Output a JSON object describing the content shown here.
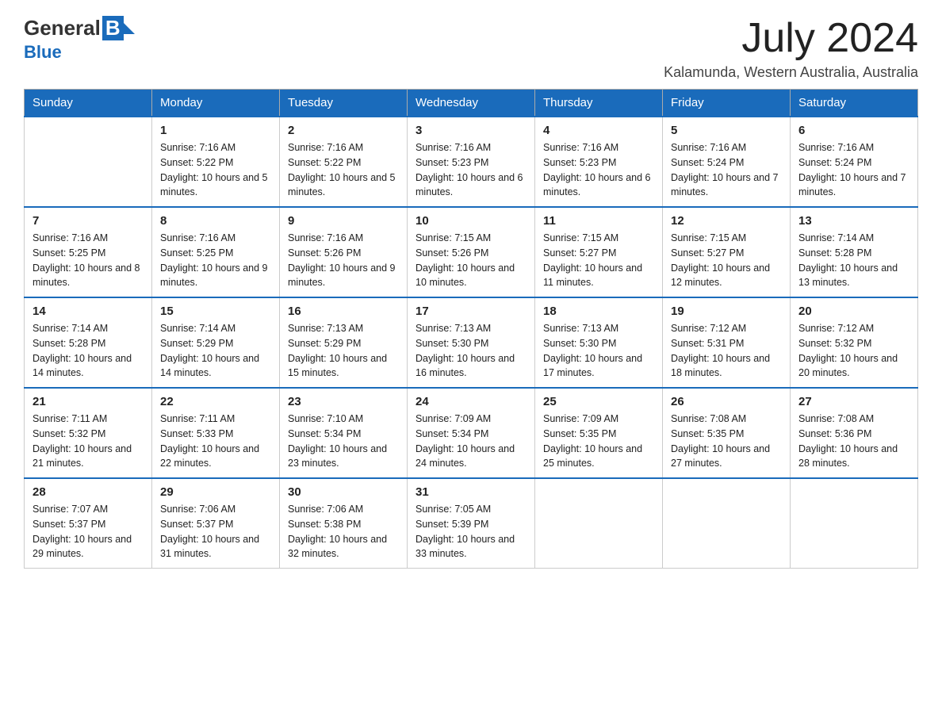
{
  "logo": {
    "general": "General",
    "blue": "Blue",
    "subtitle": "Blue"
  },
  "title": {
    "month_year": "July 2024",
    "location": "Kalamunda, Western Australia, Australia"
  },
  "days_of_week": [
    "Sunday",
    "Monday",
    "Tuesday",
    "Wednesday",
    "Thursday",
    "Friday",
    "Saturday"
  ],
  "weeks": [
    [
      null,
      {
        "day": "1",
        "sunrise": "7:16 AM",
        "sunset": "5:22 PM",
        "daylight": "10 hours and 5 minutes."
      },
      {
        "day": "2",
        "sunrise": "7:16 AM",
        "sunset": "5:22 PM",
        "daylight": "10 hours and 5 minutes."
      },
      {
        "day": "3",
        "sunrise": "7:16 AM",
        "sunset": "5:23 PM",
        "daylight": "10 hours and 6 minutes."
      },
      {
        "day": "4",
        "sunrise": "7:16 AM",
        "sunset": "5:23 PM",
        "daylight": "10 hours and 6 minutes."
      },
      {
        "day": "5",
        "sunrise": "7:16 AM",
        "sunset": "5:24 PM",
        "daylight": "10 hours and 7 minutes."
      },
      {
        "day": "6",
        "sunrise": "7:16 AM",
        "sunset": "5:24 PM",
        "daylight": "10 hours and 7 minutes."
      }
    ],
    [
      {
        "day": "7",
        "sunrise": "7:16 AM",
        "sunset": "5:25 PM",
        "daylight": "10 hours and 8 minutes."
      },
      {
        "day": "8",
        "sunrise": "7:16 AM",
        "sunset": "5:25 PM",
        "daylight": "10 hours and 9 minutes."
      },
      {
        "day": "9",
        "sunrise": "7:16 AM",
        "sunset": "5:26 PM",
        "daylight": "10 hours and 9 minutes."
      },
      {
        "day": "10",
        "sunrise": "7:15 AM",
        "sunset": "5:26 PM",
        "daylight": "10 hours and 10 minutes."
      },
      {
        "day": "11",
        "sunrise": "7:15 AM",
        "sunset": "5:27 PM",
        "daylight": "10 hours and 11 minutes."
      },
      {
        "day": "12",
        "sunrise": "7:15 AM",
        "sunset": "5:27 PM",
        "daylight": "10 hours and 12 minutes."
      },
      {
        "day": "13",
        "sunrise": "7:14 AM",
        "sunset": "5:28 PM",
        "daylight": "10 hours and 13 minutes."
      }
    ],
    [
      {
        "day": "14",
        "sunrise": "7:14 AM",
        "sunset": "5:28 PM",
        "daylight": "10 hours and 14 minutes."
      },
      {
        "day": "15",
        "sunrise": "7:14 AM",
        "sunset": "5:29 PM",
        "daylight": "10 hours and 14 minutes."
      },
      {
        "day": "16",
        "sunrise": "7:13 AM",
        "sunset": "5:29 PM",
        "daylight": "10 hours and 15 minutes."
      },
      {
        "day": "17",
        "sunrise": "7:13 AM",
        "sunset": "5:30 PM",
        "daylight": "10 hours and 16 minutes."
      },
      {
        "day": "18",
        "sunrise": "7:13 AM",
        "sunset": "5:30 PM",
        "daylight": "10 hours and 17 minutes."
      },
      {
        "day": "19",
        "sunrise": "7:12 AM",
        "sunset": "5:31 PM",
        "daylight": "10 hours and 18 minutes."
      },
      {
        "day": "20",
        "sunrise": "7:12 AM",
        "sunset": "5:32 PM",
        "daylight": "10 hours and 20 minutes."
      }
    ],
    [
      {
        "day": "21",
        "sunrise": "7:11 AM",
        "sunset": "5:32 PM",
        "daylight": "10 hours and 21 minutes."
      },
      {
        "day": "22",
        "sunrise": "7:11 AM",
        "sunset": "5:33 PM",
        "daylight": "10 hours and 22 minutes."
      },
      {
        "day": "23",
        "sunrise": "7:10 AM",
        "sunset": "5:34 PM",
        "daylight": "10 hours and 23 minutes."
      },
      {
        "day": "24",
        "sunrise": "7:09 AM",
        "sunset": "5:34 PM",
        "daylight": "10 hours and 24 minutes."
      },
      {
        "day": "25",
        "sunrise": "7:09 AM",
        "sunset": "5:35 PM",
        "daylight": "10 hours and 25 minutes."
      },
      {
        "day": "26",
        "sunrise": "7:08 AM",
        "sunset": "5:35 PM",
        "daylight": "10 hours and 27 minutes."
      },
      {
        "day": "27",
        "sunrise": "7:08 AM",
        "sunset": "5:36 PM",
        "daylight": "10 hours and 28 minutes."
      }
    ],
    [
      {
        "day": "28",
        "sunrise": "7:07 AM",
        "sunset": "5:37 PM",
        "daylight": "10 hours and 29 minutes."
      },
      {
        "day": "29",
        "sunrise": "7:06 AM",
        "sunset": "5:37 PM",
        "daylight": "10 hours and 31 minutes."
      },
      {
        "day": "30",
        "sunrise": "7:06 AM",
        "sunset": "5:38 PM",
        "daylight": "10 hours and 32 minutes."
      },
      {
        "day": "31",
        "sunrise": "7:05 AM",
        "sunset": "5:39 PM",
        "daylight": "10 hours and 33 minutes."
      },
      null,
      null,
      null
    ]
  ]
}
